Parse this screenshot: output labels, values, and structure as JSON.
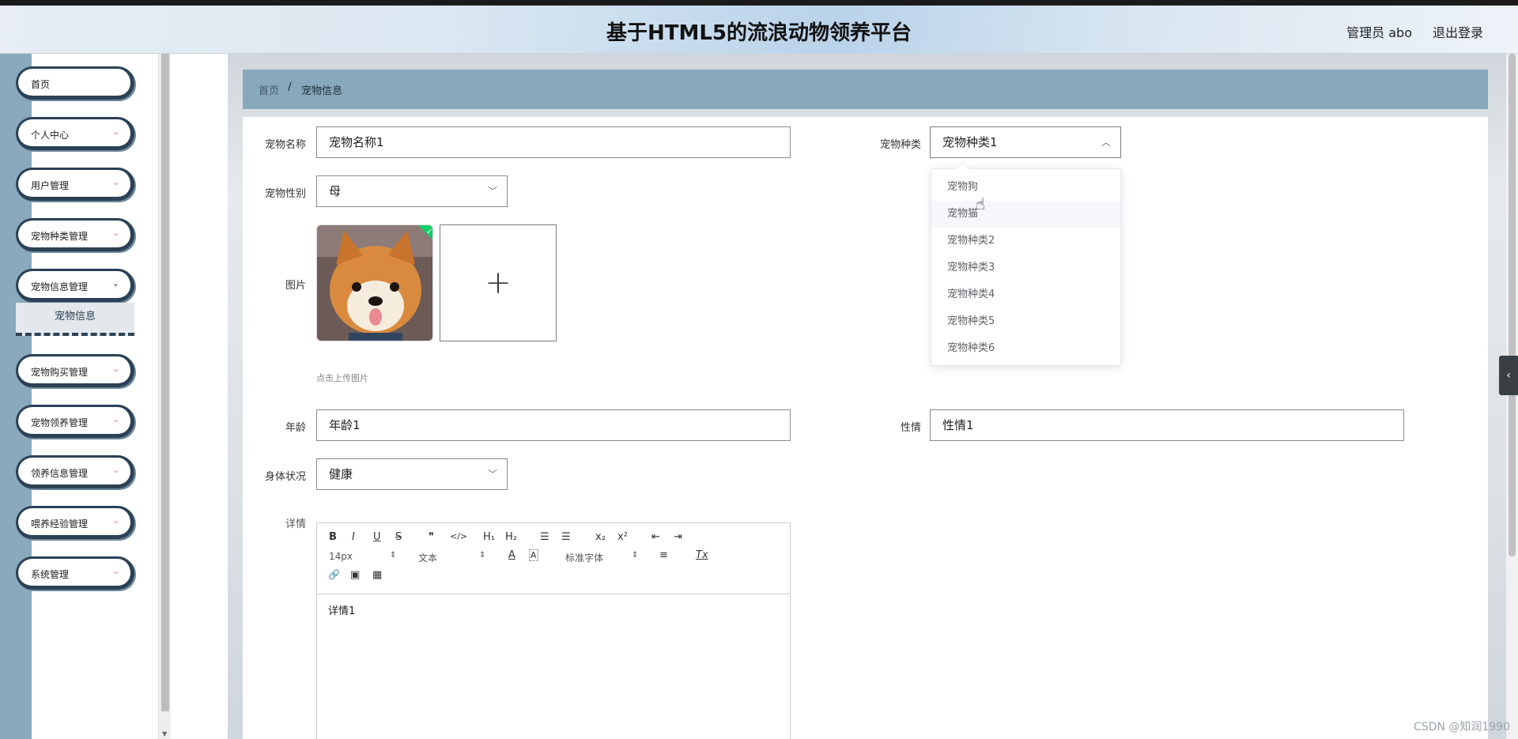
{
  "header": {
    "title": "基于HTML5的流浪动物领养平台",
    "user": "管理员 abo",
    "logout": "退出登录"
  },
  "sidebar": {
    "items": [
      {
        "label": "首页",
        "has_children": false
      },
      {
        "label": "个人中心",
        "has_children": true
      },
      {
        "label": "用户管理",
        "has_children": true
      },
      {
        "label": "宠物种类管理",
        "has_children": true
      },
      {
        "label": "宠物信息管理",
        "has_children": true
      },
      {
        "label": "宠物购买管理",
        "has_children": true
      },
      {
        "label": "宠物领养管理",
        "has_children": true
      },
      {
        "label": "领养信息管理",
        "has_children": true
      },
      {
        "label": "喂养经验管理",
        "has_children": true
      },
      {
        "label": "系统管理",
        "has_children": true
      }
    ],
    "active_sub": "宠物信息"
  },
  "breadcrumb": {
    "home": "首页",
    "separator": "/",
    "current": "宠物信息"
  },
  "form": {
    "name_label": "宠物名称",
    "name_value": "宠物名称1",
    "type_label": "宠物种类",
    "type_value": "宠物种类1",
    "gender_label": "宠物性别",
    "gender_value": "母",
    "image_label": "图片",
    "upload_plus": "+",
    "upload_tip": "点击上传图片",
    "age_label": "年龄",
    "age_value": "年龄1",
    "temper_label": "性情",
    "temper_value": "性情1",
    "health_label": "身体状况",
    "health_value": "健康",
    "detail_label": "详情",
    "detail_value": "详情1"
  },
  "editor_toolbar": {
    "bold": "B",
    "italic": "I",
    "underline": "U",
    "strike": "S",
    "quote": "❞",
    "code": "</>",
    "h1": "H₁",
    "h2": "H₂",
    "ordered": "☰",
    "bullet": "☰",
    "sub": "x₂",
    "sup": "x²",
    "outdent": "⇤",
    "indent": "⇥",
    "size": "14px",
    "text": "文本",
    "color": "A",
    "bg": "A",
    "font": "标准字体",
    "align": "≡",
    "clear": "Tx",
    "link": "🔗",
    "image": "▣",
    "video": "▦"
  },
  "dropdown": {
    "options": [
      "宠物狗",
      "宠物猫",
      "宠物种类2",
      "宠物种类3",
      "宠物种类4",
      "宠物种类5",
      "宠物种类6"
    ],
    "hovered_index": 1
  },
  "watermark": "CSDN @知润1990",
  "colors": {
    "sidebar_accent": "#2b4156",
    "breadcrumb_bg": "#88a9bb",
    "success_check": "#13ce66"
  }
}
